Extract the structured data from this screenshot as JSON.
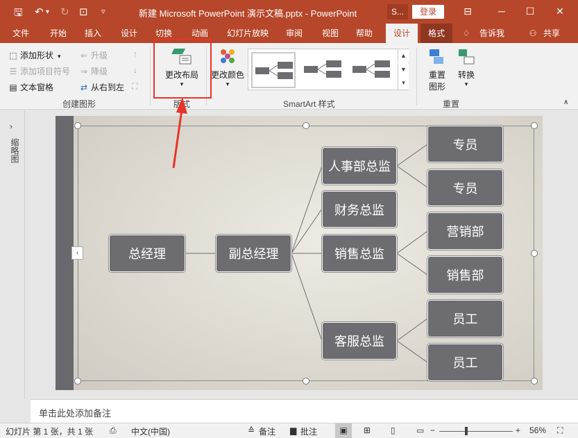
{
  "window": {
    "title": "新建 Microsoft PowerPoint 演示文稿.pptx  -  PowerPoint",
    "s_tab": "S...",
    "login": "登录"
  },
  "tabs": [
    {
      "label": "文件"
    },
    {
      "label": "开始"
    },
    {
      "label": "插入"
    },
    {
      "label": "设计"
    },
    {
      "label": "切换"
    },
    {
      "label": "动画"
    },
    {
      "label": "幻灯片放映"
    },
    {
      "label": "审阅"
    },
    {
      "label": "视图"
    },
    {
      "label": "帮助"
    },
    {
      "label": "设计"
    },
    {
      "label": "格式"
    },
    {
      "label": "告诉我"
    },
    {
      "label": "共享"
    }
  ],
  "ribbon": {
    "add_shape": "添加形状",
    "add_bullet": "添加项目符号",
    "text_pane": "文本窗格",
    "promote": "升级",
    "demote": "降级",
    "rtl": "从右到左",
    "group_create": "创建图形",
    "change_layout": "更改布局",
    "group_layout": "版式",
    "change_colors": "更改颜色",
    "group_styles": "SmartArt 样式",
    "reset": "重置",
    "reset2": "图形",
    "convert": "转换",
    "group_reset": "重置"
  },
  "leftpane": {
    "label": "缩略图"
  },
  "org": {
    "ceo": "总经理",
    "deputy": "副总经理",
    "hr": "人事部总监",
    "finance": "财务总监",
    "sales": "销售总监",
    "service": "客服总监",
    "hr_staff1": "专员",
    "hr_staff2": "专员",
    "sales_dept1": "营销部",
    "sales_dept2": "销售部",
    "svc_staff1": "员工",
    "svc_staff2": "员工"
  },
  "notes": {
    "placeholder": "单击此处添加备注"
  },
  "status": {
    "slide": "幻灯片 第 1 张，共 1 张",
    "lang": "中文(中国)",
    "notes": "备注",
    "comments": "批注",
    "zoom": "56%"
  },
  "colors": {
    "accent": "#b7472a",
    "node_fill": "#6d6c71",
    "highlight": "#e8332a"
  }
}
